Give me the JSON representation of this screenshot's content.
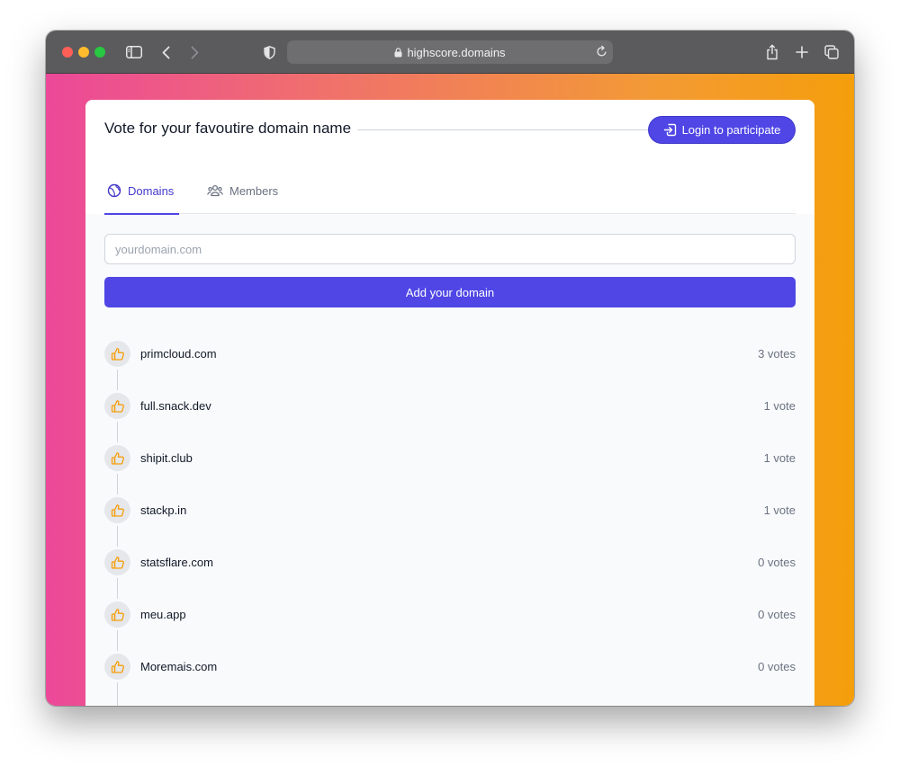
{
  "browser": {
    "url": "highscore.domains"
  },
  "header": {
    "title": "Vote for your favoutire domain name",
    "login_label": "Login to participate"
  },
  "tabs": [
    {
      "label": "Domains",
      "active": true
    },
    {
      "label": "Members",
      "active": false
    }
  ],
  "form": {
    "placeholder": "yourdomain.com",
    "value": "",
    "submit_label": "Add your domain"
  },
  "domains": [
    {
      "name": "primcloud.com",
      "votes": "3 votes"
    },
    {
      "name": "full.snack.dev",
      "votes": "1 vote"
    },
    {
      "name": "shipit.club",
      "votes": "1 vote"
    },
    {
      "name": "stackp.in",
      "votes": "1 vote"
    },
    {
      "name": "statsflare.com",
      "votes": "0 votes"
    },
    {
      "name": "meu.app",
      "votes": "0 votes"
    },
    {
      "name": "Moremais.com",
      "votes": "0 votes"
    }
  ],
  "colors": {
    "accent": "#4f46e5",
    "thumb_icon": "#f59e0b",
    "gradient_start": "#ec4899",
    "gradient_end": "#f59e0b"
  }
}
